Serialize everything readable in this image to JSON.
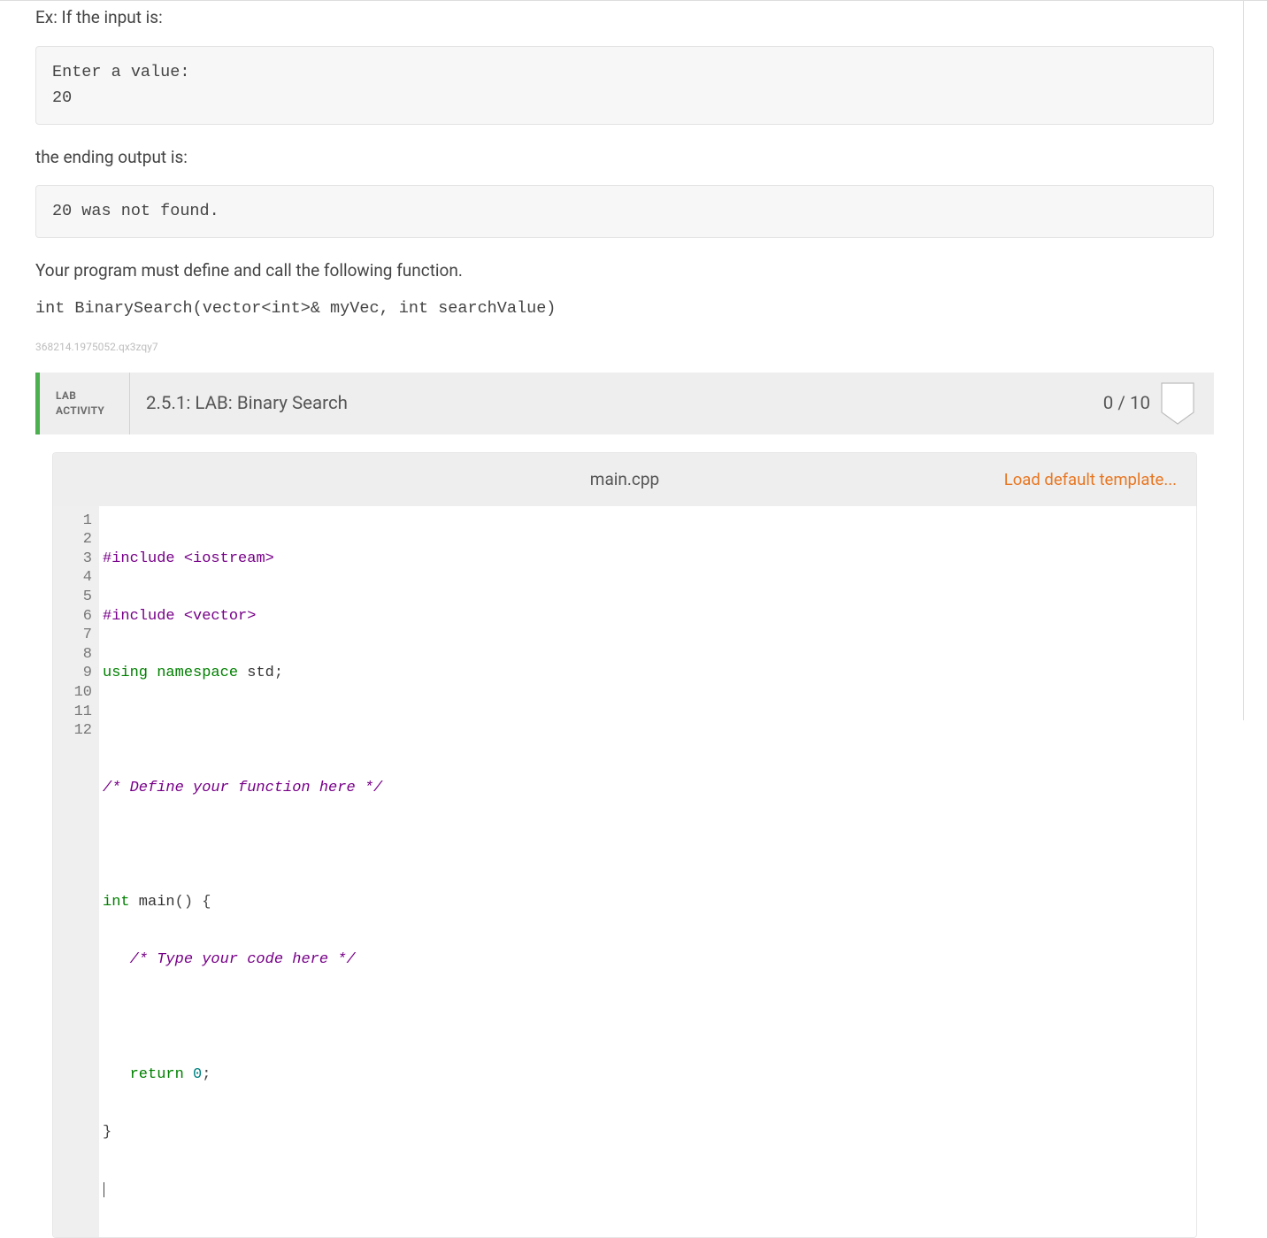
{
  "intro": {
    "ex_label": "Ex: If the input is:",
    "input_box": "Enter a value:\n20",
    "ending_label": "the ending output is:",
    "output_box": "20 was not found.",
    "requirement": "Your program must define and call the following function.",
    "signature": "int BinarySearch(vector<int>& myVec, int searchValue)",
    "session_id": "368214.1975052.qx3zqy7"
  },
  "lab": {
    "activity_label_line1": "LAB",
    "activity_label_line2": "ACTIVITY",
    "title": "2.5.1: LAB: Binary Search",
    "score": "0 / 10"
  },
  "editor": {
    "filename": "main.cpp",
    "load_default_label": "Load default template...",
    "line_numbers": [
      "1",
      "2",
      "3",
      "4",
      "5",
      "6",
      "7",
      "8",
      "9",
      "10",
      "11",
      "12"
    ],
    "code": {
      "l1_a": "#include ",
      "l1_b": "<iostream>",
      "l2_a": "#include ",
      "l2_b": "<vector>",
      "l3_a": "using",
      "l3_b": " namespace",
      "l3_c": " std",
      "l3_d": ";",
      "l4": "",
      "l5": "/* Define your function here */",
      "l6": "",
      "l7_a": "int",
      "l7_b": " main",
      "l7_c": "()",
      "l7_d": " {",
      "l8_a": "   ",
      "l8_b": "/* Type your code here */",
      "l9": "",
      "l10_a": "   ",
      "l10_b": "return",
      "l10_c": " ",
      "l10_d": "0",
      "l10_e": ";",
      "l11": "}",
      "l12": ""
    }
  }
}
